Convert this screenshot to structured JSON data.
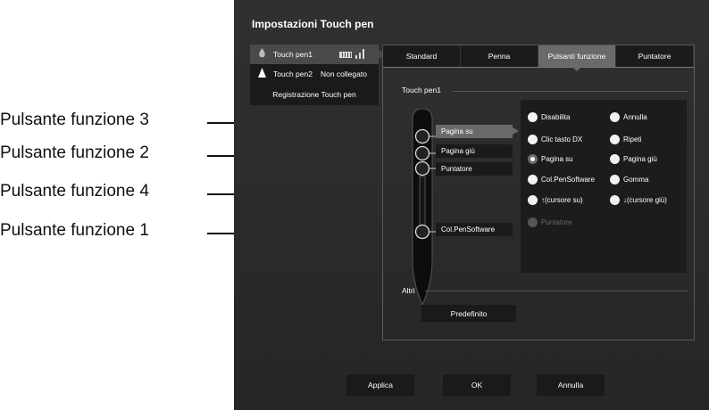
{
  "callouts": [
    {
      "label": "Pulsante funzione 3"
    },
    {
      "label": "Pulsante funzione 2"
    },
    {
      "label": "Pulsante funzione 4"
    },
    {
      "label": "Pulsante funzione 1"
    }
  ],
  "window": {
    "title": "Impostazioni Touch pen"
  },
  "pens": [
    {
      "name": "Touch pen1",
      "status": ""
    },
    {
      "name": "Touch pen2",
      "status": "Non collegato"
    }
  ],
  "register_label": "Registrazione Touch pen",
  "tabs": [
    "Standard",
    "Penna",
    "Pulsanti funzione",
    "Puntatore"
  ],
  "section_pen": "Touch pen1",
  "section_other": "Altri",
  "function_buttons": [
    "Pagina su",
    "Pagina giù",
    "Puntatore",
    "Col.PenSoftware"
  ],
  "options": [
    "Disabilita",
    "Annulla",
    "Clic tasto DX",
    "Ripeti",
    "Pagina su",
    "Pagina giù",
    "Col.PenSoftware",
    "Gomma",
    "↑(cursore su)",
    "↓(cursore giù)",
    "Puntatore"
  ],
  "selected_option": "Pagina su",
  "default_label": "Predefinito",
  "bottom_buttons": {
    "apply": "Applica",
    "ok": "OK",
    "cancel": "Annulla"
  }
}
